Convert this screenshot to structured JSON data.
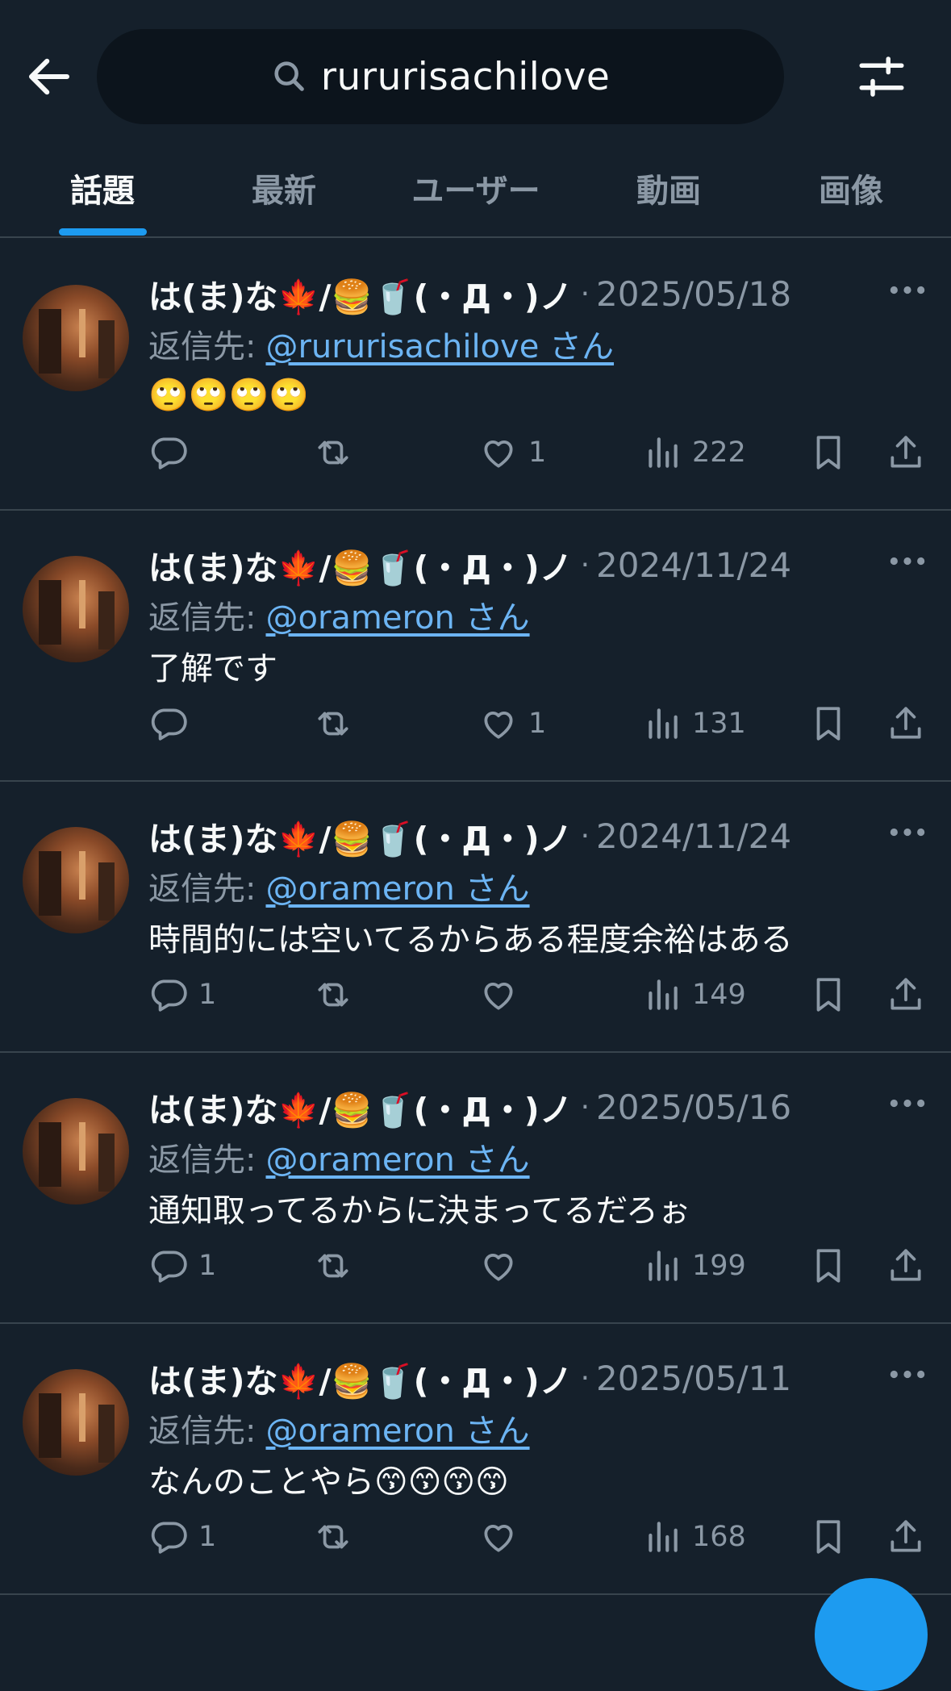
{
  "search": {
    "query": "rururisachilove"
  },
  "tabs": [
    "話題",
    "最新",
    "ユーザー",
    "動画",
    "画像"
  ],
  "reply_prefix": "返信先:",
  "posts": [
    {
      "name": "は(ま)な🍁/🍔🥤(・Д・)ノ",
      "date": "2025/05/18",
      "reply_to": "@rururisachilove さん",
      "text": "🙄🙄🙄🙄",
      "replies": "",
      "likes": "1",
      "views": "222"
    },
    {
      "name": "は(ま)な🍁/🍔🥤(・Д・)ノ",
      "date": "2024/11/24",
      "reply_to": "@orameron さん",
      "text": "了解です",
      "replies": "",
      "likes": "1",
      "views": "131"
    },
    {
      "name": "は(ま)な🍁/🍔🥤(・Д・)ノ",
      "date": "2024/11/24",
      "reply_to": "@orameron さん",
      "text": "時間的には空いてるからある程度余裕はある",
      "replies": "1",
      "likes": "",
      "views": "149"
    },
    {
      "name": "は(ま)な🍁/🍔🥤(・Д・)ノ",
      "date": "2025/05/16",
      "reply_to": "@orameron さん",
      "text": "通知取ってるからに決まってるだろぉ",
      "replies": "1",
      "likes": "",
      "views": "199"
    },
    {
      "name": "は(ま)な🍁/🍔🥤(・Д・)ノ",
      "date": "2025/05/11",
      "reply_to": "@orameron さん",
      "text": "なんのことやら😙😙😙😙",
      "replies": "1",
      "likes": "",
      "views": "168"
    }
  ],
  "colors": {
    "background": "#15202b",
    "accent": "#1d9bf0",
    "secondary_text": "#8b98a5",
    "link": "#6cb4f3"
  }
}
